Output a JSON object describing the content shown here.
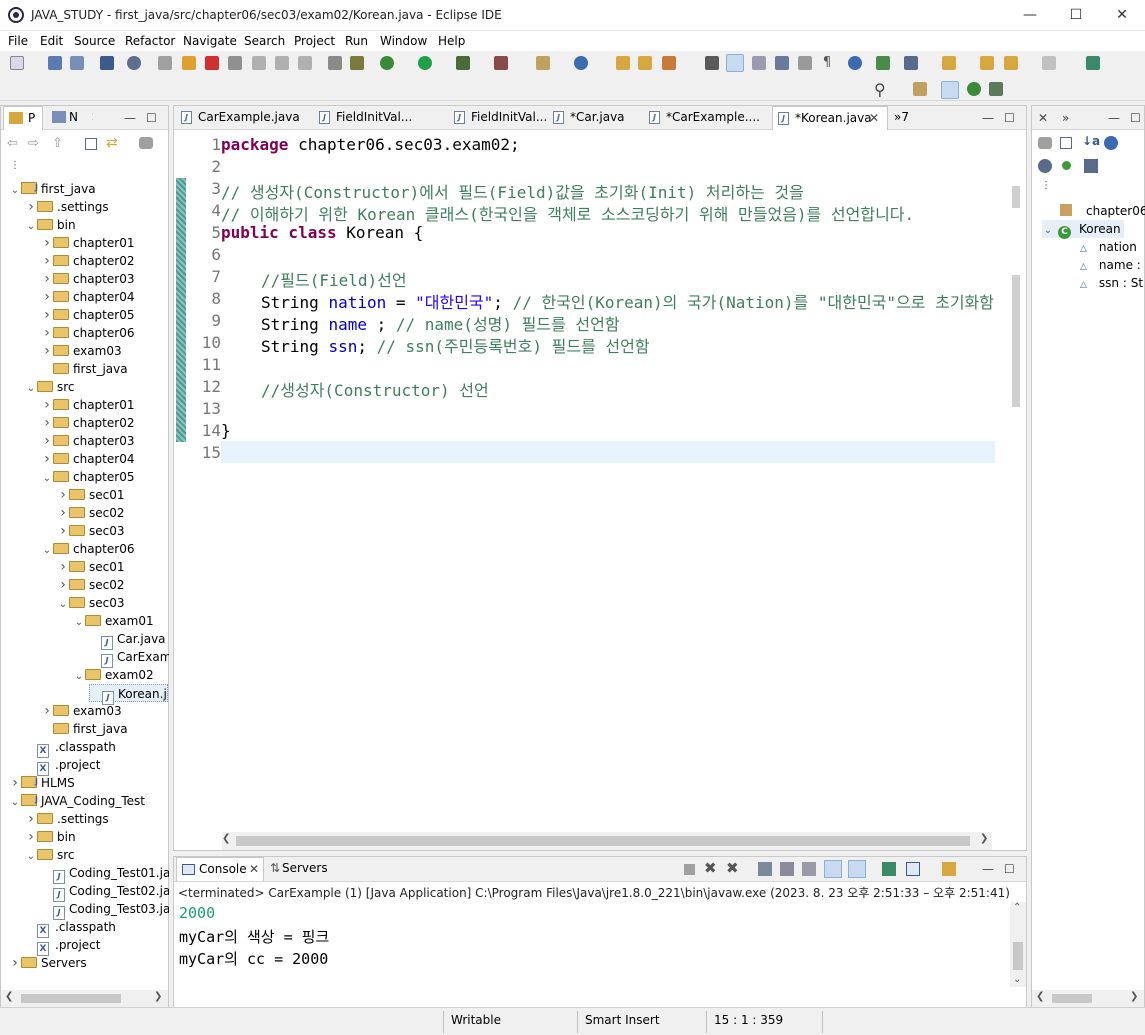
{
  "window": {
    "title": "JAVA_STUDY - first_java/src/chapter06/sec03/exam02/Korean.java - Eclipse IDE"
  },
  "menu": [
    "File",
    "Edit",
    "Source",
    "Refactor",
    "Navigate",
    "Search",
    "Project",
    "Run",
    "Window",
    "Help"
  ],
  "left_panel": {
    "tabs": [
      "P",
      "N"
    ],
    "tree": [
      {
        "label": "first_java",
        "depth": 0,
        "type": "project",
        "expanded": true
      },
      {
        "label": ".settings",
        "depth": 1,
        "type": "folder",
        "expanded": false
      },
      {
        "label": "bin",
        "depth": 1,
        "type": "folder",
        "expanded": true
      },
      {
        "label": "chapter01",
        "depth": 2,
        "type": "folder",
        "expanded": false
      },
      {
        "label": "chapter02",
        "depth": 2,
        "type": "folder",
        "expanded": false
      },
      {
        "label": "chapter03",
        "depth": 2,
        "type": "folder",
        "expanded": false
      },
      {
        "label": "chapter04",
        "depth": 2,
        "type": "folder",
        "expanded": false
      },
      {
        "label": "chapter05",
        "depth": 2,
        "type": "folder",
        "expanded": false
      },
      {
        "label": "chapter06",
        "depth": 2,
        "type": "folder",
        "expanded": false
      },
      {
        "label": "exam03",
        "depth": 2,
        "type": "folder",
        "expanded": false
      },
      {
        "label": "first_java",
        "depth": 2,
        "type": "folder",
        "expanded": null
      },
      {
        "label": "src",
        "depth": 1,
        "type": "folder",
        "expanded": true
      },
      {
        "label": "chapter01",
        "depth": 2,
        "type": "folder",
        "expanded": false
      },
      {
        "label": "chapter02",
        "depth": 2,
        "type": "folder",
        "expanded": false
      },
      {
        "label": "chapter03",
        "depth": 2,
        "type": "folder",
        "expanded": false
      },
      {
        "label": "chapter04",
        "depth": 2,
        "type": "folder",
        "expanded": false
      },
      {
        "label": "chapter05",
        "depth": 2,
        "type": "folder",
        "expanded": true
      },
      {
        "label": "sec01",
        "depth": 3,
        "type": "folder",
        "expanded": false
      },
      {
        "label": "sec02",
        "depth": 3,
        "type": "folder",
        "expanded": false
      },
      {
        "label": "sec03",
        "depth": 3,
        "type": "folder",
        "expanded": false
      },
      {
        "label": "chapter06",
        "depth": 2,
        "type": "folder",
        "expanded": true
      },
      {
        "label": "sec01",
        "depth": 3,
        "type": "folder",
        "expanded": false
      },
      {
        "label": "sec02",
        "depth": 3,
        "type": "folder",
        "expanded": false
      },
      {
        "label": "sec03",
        "depth": 3,
        "type": "folder",
        "expanded": true
      },
      {
        "label": "exam01",
        "depth": 4,
        "type": "folder",
        "expanded": true
      },
      {
        "label": "Car.java",
        "depth": 5,
        "type": "java",
        "expanded": null
      },
      {
        "label": "CarExam",
        "depth": 5,
        "type": "java",
        "expanded": null
      },
      {
        "label": "exam02",
        "depth": 4,
        "type": "folder",
        "expanded": true
      },
      {
        "label": "Korean.j",
        "depth": 5,
        "type": "java",
        "expanded": null,
        "selected": true
      },
      {
        "label": "exam03",
        "depth": 2,
        "type": "folder",
        "expanded": false
      },
      {
        "label": "first_java",
        "depth": 2,
        "type": "folder",
        "expanded": null
      },
      {
        "label": ".classpath",
        "depth": 1,
        "type": "x",
        "expanded": null
      },
      {
        "label": ".project",
        "depth": 1,
        "type": "x",
        "expanded": null
      },
      {
        "label": "HLMS",
        "depth": 0,
        "type": "project",
        "expanded": false
      },
      {
        "label": "JAVA_Coding_Test",
        "depth": 0,
        "type": "project",
        "expanded": true
      },
      {
        "label": ".settings",
        "depth": 1,
        "type": "folder",
        "expanded": false
      },
      {
        "label": "bin",
        "depth": 1,
        "type": "folder",
        "expanded": false
      },
      {
        "label": "src",
        "depth": 1,
        "type": "folder",
        "expanded": true
      },
      {
        "label": "Coding_Test01.ja",
        "depth": 2,
        "type": "java",
        "expanded": null
      },
      {
        "label": "Coding_Test02.ja",
        "depth": 2,
        "type": "java",
        "expanded": null
      },
      {
        "label": "Coding_Test03.ja",
        "depth": 2,
        "type": "java",
        "expanded": null
      },
      {
        "label": ".classpath",
        "depth": 1,
        "type": "x",
        "expanded": null
      },
      {
        "label": ".project",
        "depth": 1,
        "type": "x",
        "expanded": null
      },
      {
        "label": "Servers",
        "depth": 0,
        "type": "folder",
        "expanded": false
      }
    ]
  },
  "editor": {
    "tabs": [
      {
        "label": "CarExample.java",
        "active": false
      },
      {
        "label": "FieldInitVal...",
        "active": false
      },
      {
        "label": "FieldInitVal...",
        "active": false
      },
      {
        "label": "*Car.java",
        "active": false
      },
      {
        "label": "*CarExample....",
        "active": false
      },
      {
        "label": "*Korean.java",
        "active": true
      }
    ],
    "overflow": "»7",
    "line_numbers": [
      "1",
      "2",
      "3",
      "4",
      "5",
      "6",
      "7",
      "8",
      "9",
      "10",
      "11",
      "12",
      "13",
      "14",
      "15"
    ],
    "lines": {
      "l1_kw": "package",
      "l1_rest": " chapter06.sec03.exam02;",
      "l3": "// 생성자(Constructor)에서 필드(Field)값을 초기화(Init) 처리하는 것을",
      "l4": "// 이해하기 위한 Korean 클래스(한국인을 객체로 소스코딩하기 위해 만들었음)를 선언합니다.",
      "l5_kw": "public class",
      "l5_rest": " Korean {",
      "l7": "//필드(Field)선언",
      "l8_type": "String ",
      "l8_field": "nation",
      "l8_eq": " = ",
      "l8_str": "\"대한민국\"",
      "l8_semi": "; ",
      "l8_cm": "// 한국인(Korean)의 국가(Nation)를 \"대한민국\"으로 초기화함",
      "l9_type": "String ",
      "l9_field": "name",
      "l9_semi": " ; ",
      "l9_cm": "// name(성명) 필드를 선언함",
      "l10_type": "String ",
      "l10_field": "ssn",
      "l10_semi": "; ",
      "l10_cm": "// ssn(주민등록번호) 필드를 선언함",
      "l12": "//생성자(Constructor) 선언",
      "l14": "}"
    }
  },
  "outline": {
    "items": [
      {
        "label": "chapter06",
        "type": "package"
      },
      {
        "label": "Korean",
        "type": "class"
      },
      {
        "label": "nation",
        "type": "field"
      },
      {
        "label": "name :",
        "type": "field"
      },
      {
        "label": "ssn : St",
        "type": "field"
      }
    ]
  },
  "console": {
    "tabs": [
      "Console",
      "Servers"
    ],
    "header": "<terminated> CarExample (1) [Java Application] C:\\Program Files\\Java\\jre1.8.0_221\\bin\\javaw.exe  (2023. 8. 23 오후 2:51:33 – 오후 2:51:41)",
    "lines": [
      "2000",
      "myCar의 색상 = 핑크",
      "myCar의 cc = 2000"
    ]
  },
  "status": {
    "writable": "Writable",
    "insert_mode": "Smart Insert",
    "position": "15 : 1 : 359"
  },
  "colors": {
    "keyword": "#7f0055",
    "comment": "#3f7f5f",
    "string": "#2a00ff",
    "field": "#0000c0",
    "change_bar": "#4f9a94"
  }
}
